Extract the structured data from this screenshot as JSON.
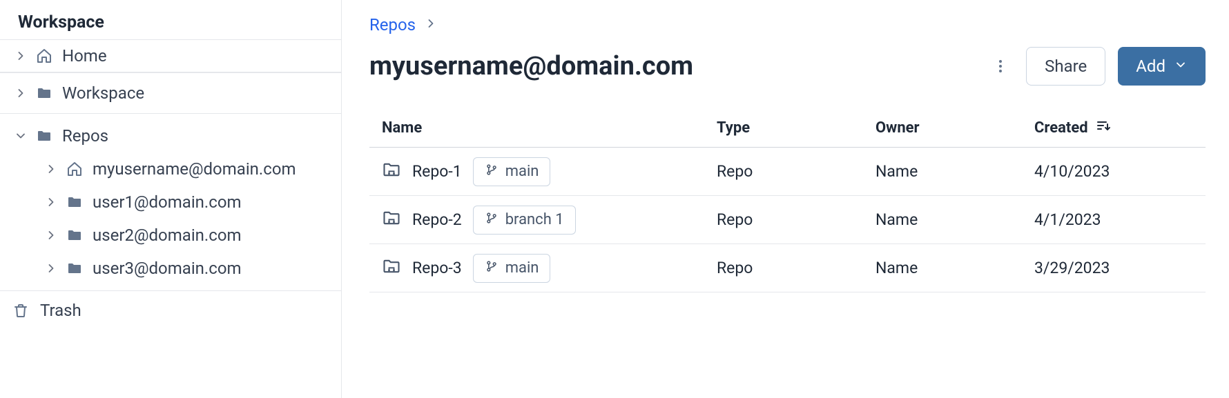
{
  "sidebar": {
    "title": "Workspace",
    "home_label": "Home",
    "workspace_label": "Workspace",
    "repos_label": "Repos",
    "users": [
      {
        "label": "myusername@domain.com",
        "icon": "home"
      },
      {
        "label": "user1@domain.com",
        "icon": "folder"
      },
      {
        "label": "user2@domain.com",
        "icon": "folder"
      },
      {
        "label": "user3@domain.com",
        "icon": "folder"
      }
    ],
    "trash_label": "Trash"
  },
  "breadcrumb": {
    "items": [
      "Repos"
    ]
  },
  "header": {
    "title": "myusername@domain.com",
    "share_label": "Share",
    "add_label": "Add"
  },
  "table": {
    "columns": {
      "name": "Name",
      "type": "Type",
      "owner": "Owner",
      "created": "Created"
    },
    "rows": [
      {
        "name": "Repo-1",
        "branch": "main",
        "type": "Repo",
        "owner": "Name",
        "created": "4/10/2023"
      },
      {
        "name": "Repo-2",
        "branch": "branch 1",
        "type": "Repo",
        "owner": "Name",
        "created": "4/1/2023"
      },
      {
        "name": "Repo-3",
        "branch": "main",
        "type": "Repo",
        "owner": "Name",
        "created": "3/29/2023"
      }
    ]
  }
}
